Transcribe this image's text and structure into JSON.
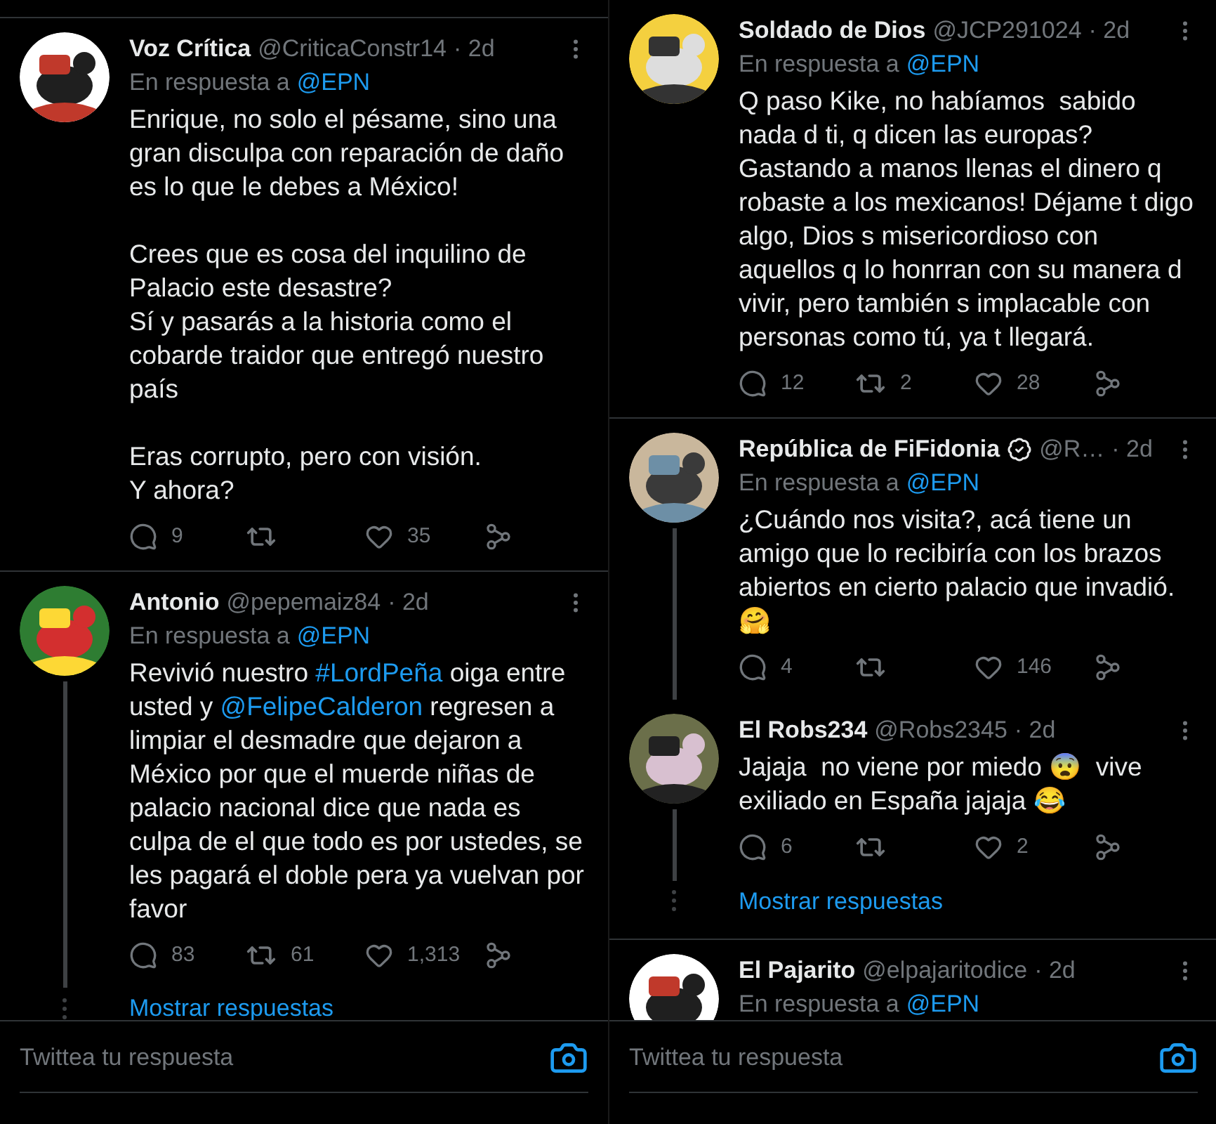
{
  "panels": [
    {
      "items": [
        {
          "kind": "tweet",
          "name": "Voz Crítica",
          "handle": "@CriticaConstr14",
          "time": "· 2d",
          "verified": false,
          "thread": false,
          "reply_to_label": "En respuesta a",
          "reply_to": "@EPN",
          "body": [
            {
              "kind": "text",
              "text": "Enrique, no solo el pésame, sino una gran disculpa con reparación de daño es lo que le debes a México!\n\nCrees que es cosa del inquilino de Palacio este desastre?\nSí y pasarás a la historia como el cobarde traidor que entregó nuestro país\n\nEras corrupto, pero con visión.\nY ahora?"
            }
          ],
          "replies": "9",
          "likes": "35"
        },
        {
          "kind": "tweet",
          "name": "Antonio",
          "handle": "@pepemaiz84",
          "time": "· 2d",
          "verified": false,
          "thread": true,
          "reply_to_label": "En respuesta a",
          "reply_to": "@EPN",
          "body": [
            {
              "kind": "text",
              "text": "Revivió nuestro "
            },
            {
              "kind": "link",
              "text": "#LordPeña"
            },
            {
              "kind": "text",
              "text": " oiga entre usted y "
            },
            {
              "kind": "link",
              "text": "@FelipeCalderon"
            },
            {
              "kind": "text",
              "text": " regresen a limpiar el desmadre que dejaron a México por que el muerde niñas de palacio nacional dice que nada es culpa de el que todo es por ustedes, se les pagará el doble pera ya vuelvan por favor"
            }
          ],
          "replies": "83",
          "retweets": "61",
          "likes": "1,313"
        },
        {
          "kind": "show_replies",
          "text": "Mostrar respuestas"
        }
      ],
      "reply_bar": {
        "placeholder": "Twittea tu respuesta"
      }
    },
    {
      "items": [
        {
          "kind": "tweet",
          "name": "Soldado de Dios",
          "handle": "@JCP291024",
          "time": "· 2d",
          "verified": false,
          "thread": false,
          "reply_to_label": "En respuesta a",
          "reply_to": "@EPN",
          "body": [
            {
              "kind": "text",
              "text": "Q paso Kike, no habíamos  sabido nada d ti, q dicen las europas? Gastando a manos llenas el dinero q robaste a los mexicanos! Déjame t digo algo, Dios s misericordioso con aquellos q lo honrran con su manera d vivir, pero también s implacable con personas como tú, ya t llegará."
            }
          ],
          "replies": "12",
          "retweets": "2",
          "likes": "28"
        },
        {
          "kind": "tweet",
          "name": "República de FiFidonia",
          "handle": "@R…",
          "time": "· 2d",
          "verified": true,
          "thread": true,
          "reply_to_label": "En respuesta a",
          "reply_to": "@EPN",
          "body": [
            {
              "kind": "text",
              "text": "¿Cuándo nos visita?, acá tiene un amigo que lo recibiría con los brazos abiertos en cierto palacio que invadió. 🤗"
            }
          ],
          "replies": "4",
          "likes": "146"
        },
        {
          "kind": "tweet",
          "name": "El Robs234",
          "handle": "@Robs2345",
          "time": "· 2d",
          "verified": false,
          "thread": true,
          "body": [
            {
              "kind": "text",
              "text": "Jajaja  no viene por miedo 😨  vive exiliado en España jajaja 😂"
            }
          ],
          "replies": "6",
          "likes": "2"
        },
        {
          "kind": "show_replies",
          "text": "Mostrar respuestas"
        },
        {
          "kind": "tweet",
          "name": "El Pajarito",
          "handle": "@elpajaritodice",
          "time": "· 2d",
          "verified": false,
          "thread": false,
          "reply_to_label": "En respuesta a",
          "reply_to": "@EPN"
        }
      ],
      "reply_bar": {
        "placeholder": "Twittea tu respuesta"
      }
    }
  ]
}
